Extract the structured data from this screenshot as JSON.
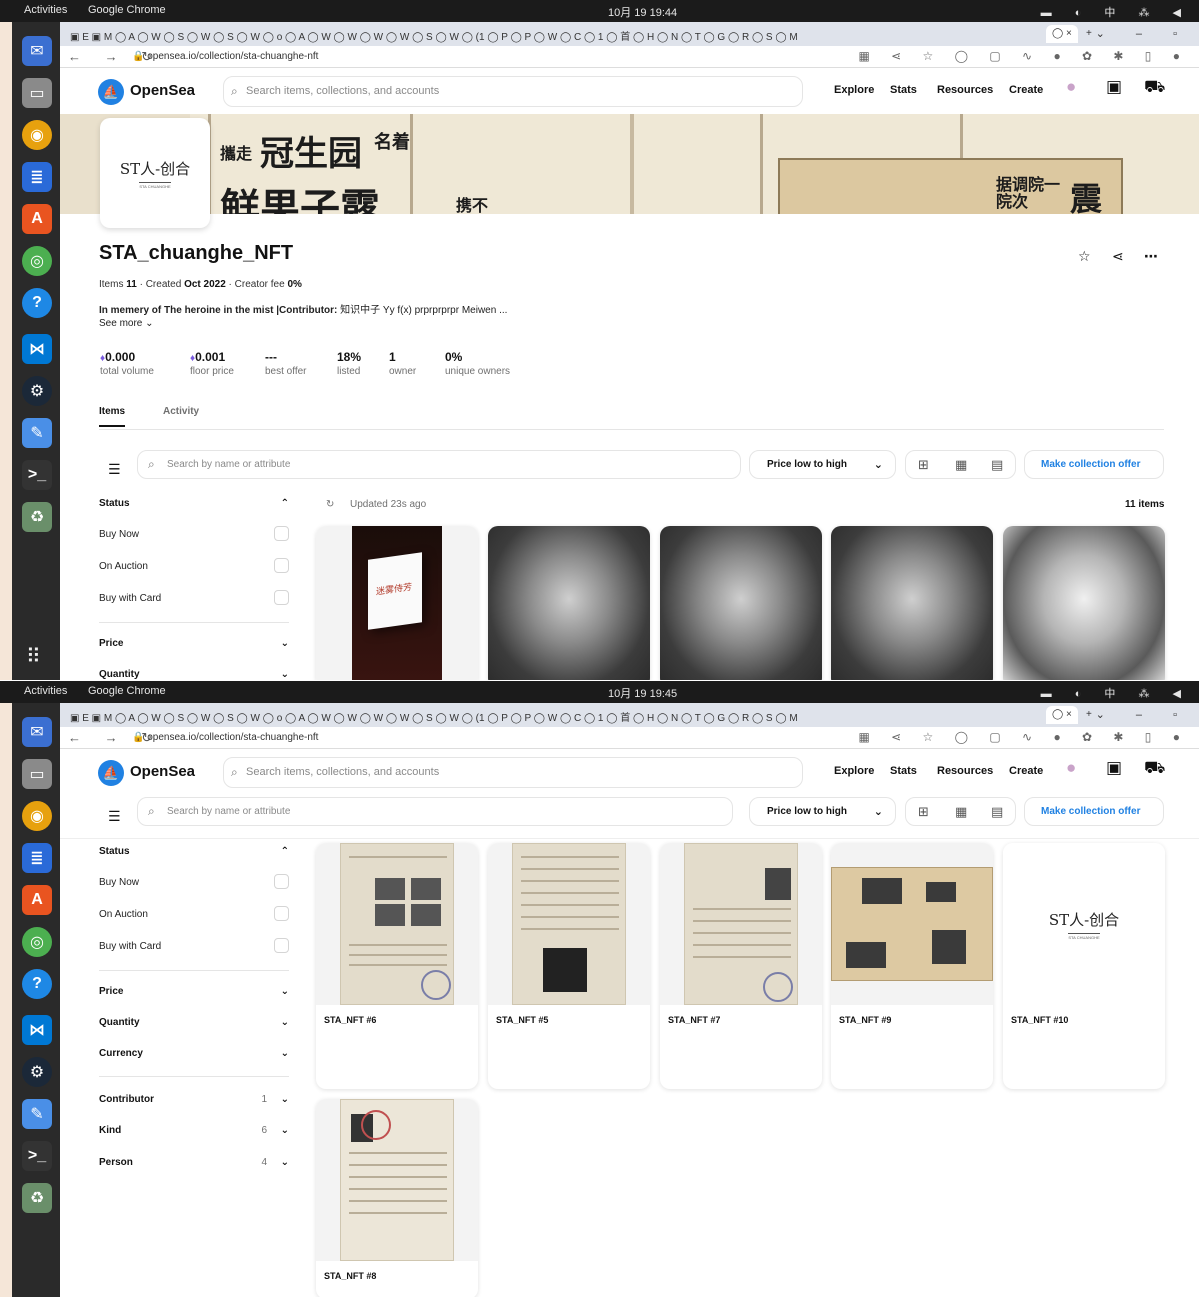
{
  "system": {
    "activities": "Activities",
    "app": "Google Chrome"
  },
  "shots": [
    {
      "clock": "10月 19 19:44"
    },
    {
      "clock": "10月 19 19:45"
    }
  ],
  "tray": "中",
  "browser": {
    "url": "opensea.io/collection/sta-chuanghe-nft"
  },
  "header": {
    "brand": "OpenSea",
    "search_placeholder": "Search items, collections, and accounts",
    "nav": [
      "Explore",
      "Stats",
      "Resources",
      "Create"
    ]
  },
  "banner": {
    "text1": "冠生园",
    "text2": "名着",
    "text3": "鲜果子露",
    "text4": "据调院一院次",
    "text5": "震",
    "text6": "携不",
    "text7": "攜走"
  },
  "collection": {
    "logo": "ST人-创合",
    "logo_sub": "STA CHUANGHE",
    "title": "STA_chuanghe_NFT",
    "items_label": "Items",
    "items_count": "11",
    "created_label": "Created",
    "created_value": "Oct 2022",
    "fee_label": "Creator fee",
    "fee_value": "0%",
    "desc_bold": "In memery of The heroine in the mist |Contributor:",
    "desc_rest": " 知识中子 Yy f(x) prprprprpr Meiwen ...",
    "see_more": "See more"
  },
  "stats": [
    {
      "value": "0.000",
      "label": "total volume",
      "eth": true
    },
    {
      "value": "0.001",
      "label": "floor price",
      "eth": true
    },
    {
      "value": "---",
      "label": "best offer",
      "eth": false
    },
    {
      "value": "18%",
      "label": "listed",
      "eth": false
    },
    {
      "value": "1",
      "label": "owner",
      "eth": false
    },
    {
      "value": "0%",
      "label": "unique owners",
      "eth": false
    }
  ],
  "tabs": [
    "Items",
    "Activity"
  ],
  "toolbar": {
    "search_placeholder": "Search by name or attribute",
    "sort": "Price low to high",
    "offer": "Make collection offer"
  },
  "filters": {
    "status": "Status",
    "status_items": [
      "Buy Now",
      "On Auction",
      "Buy with Card"
    ],
    "price": "Price",
    "quantity": "Quantity",
    "currency": "Currency",
    "contributor": "Contributor",
    "contributor_count": "1",
    "kind": "Kind",
    "kind_count": "6",
    "person": "Person",
    "person_count": "4"
  },
  "results": {
    "updated": "Updated 23s ago",
    "count": "11 items"
  },
  "cards_row2": [
    "STA_NFT #6",
    "STA_NFT #5",
    "STA_NFT #7",
    "STA_NFT #9",
    "STA_NFT #10"
  ],
  "cards_row3": [
    "STA_NFT #8"
  ],
  "book_text": "迷雾侍芳"
}
